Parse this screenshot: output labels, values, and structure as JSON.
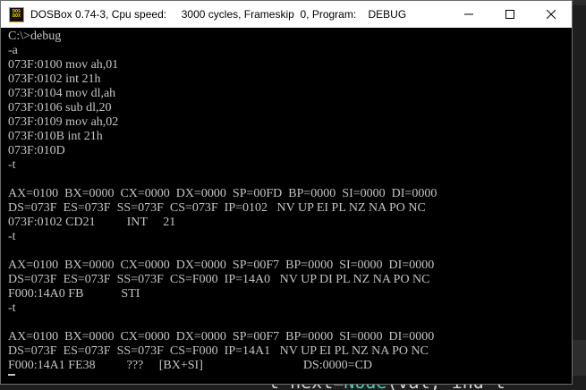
{
  "window": {
    "title": "DOSBox 0.74-3, Cpu speed:     3000 cycles, Frameskip  0, Program:    DEBUG",
    "icon_top": "DOS",
    "icon_bottom": "BOX",
    "icon": "dosbox-icon",
    "controls": [
      "minimize-icon",
      "maximize-icon",
      "close-icon"
    ]
  },
  "background": {
    "code_fragment_a": "t next=",
    "code_fragment_b": "Node",
    "code_fragment_c": "(val, ind t"
  },
  "console": {
    "lines": [
      "C:\\>debug",
      "-a",
      "073F:0100 mov ah,01",
      "073F:0102 int 21h",
      "073F:0104 mov dl,ah",
      "073F:0106 sub dl,20",
      "073F:0109 mov ah,02",
      "073F:010B int 21h",
      "073F:010D",
      "-t",
      "",
      "AX=0100  BX=0000  CX=0000  DX=0000  SP=00FD  BP=0000  SI=0000  DI=0000",
      "DS=073F  ES=073F  SS=073F  CS=073F  IP=0102   NV UP EI PL NZ NA PO NC",
      "073F:0102 CD21          INT     21",
      "-t",
      "",
      "AX=0100  BX=0000  CX=0000  DX=0000  SP=00F7  BP=0000  SI=0000  DI=0000",
      "DS=073F  ES=073F  SS=073F  CS=F000  IP=14A0   NV UP DI PL NZ NA PO NC",
      "F000:14A0 FB            STI",
      "-t",
      "",
      "AX=0100  BX=0000  CX=0000  DX=0000  SP=00F7  BP=0000  SI=0000  DI=0000",
      "DS=073F  ES=073F  SS=073F  CS=F000  IP=14A1   NV UP EI PL NZ NA PO NC",
      "F000:14A1 FE38          ???     [BX+SI]                                DS:0000=CD"
    ]
  }
}
